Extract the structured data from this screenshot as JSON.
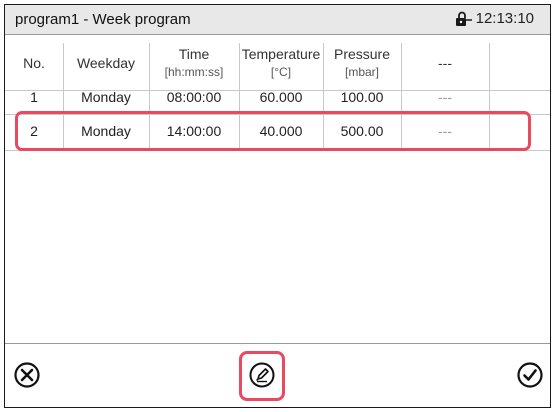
{
  "window": {
    "title": "program1 - Week program",
    "clock": "12:13:10"
  },
  "columns": [
    {
      "h1": "No.",
      "h2": ""
    },
    {
      "h1": "Weekday",
      "h2": ""
    },
    {
      "h1": "Time",
      "h2": "[hh:mm:ss]"
    },
    {
      "h1": "Temperature",
      "h2": "[°C]"
    },
    {
      "h1": "Pressure",
      "h2": "[mbar]"
    },
    {
      "h1": "---",
      "h2": ""
    }
  ],
  "rows": [
    {
      "no": "1",
      "weekday": "Monday",
      "time": "08:00:00",
      "temperature": "60.000",
      "pressure": "100.00",
      "extra": "---"
    },
    {
      "no": "2",
      "weekday": "Monday",
      "time": "14:00:00",
      "temperature": "40.000",
      "pressure": "500.00",
      "extra": "---"
    }
  ],
  "icons": {
    "cancel": "close-circle-icon",
    "edit": "pencil-circle-icon",
    "confirm": "check-circle-icon",
    "lock": "lock-icon"
  },
  "colors": {
    "highlight": "#e84a5f",
    "titlebar": "#e8e8e8"
  }
}
